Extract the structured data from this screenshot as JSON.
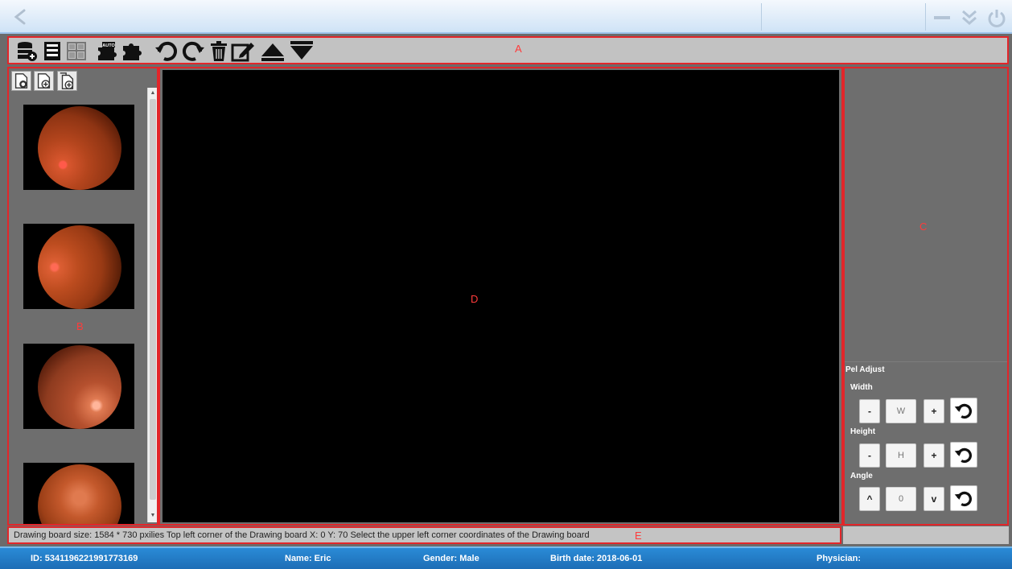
{
  "regions": {
    "toolbar": "A",
    "thumbnails": "B",
    "adjust_panel": "C",
    "drawing_board": "D",
    "status": "E"
  },
  "toolbar": {
    "tools": [
      "database-import-icon",
      "save-icon",
      "grid-icon",
      "auto-puzzle-icon",
      "puzzle-icon",
      "rotate-left-icon",
      "rotate-right-icon",
      "trash-icon",
      "edit-icon",
      "move-up-icon",
      "move-down-icon"
    ]
  },
  "thumbnail_panel": {
    "add_buttons": [
      "add-image-icon",
      "add-document-icon",
      "add-multiple-icon"
    ]
  },
  "pel_adjust": {
    "title": "Pel Adjust",
    "width": {
      "label": "Width",
      "minus": "-",
      "field": "W",
      "plus": "+"
    },
    "height": {
      "label": "Height",
      "minus": "-",
      "field": "H",
      "plus": "+"
    },
    "angle": {
      "label": "Angle",
      "up": "^",
      "field": "0",
      "down": "v"
    }
  },
  "status": {
    "text": "Drawing board size: 1584 * 730  pxilies    Top left corner of the Drawing board  X: 0  Y: 70   Select the upper left corner coordinates of the Drawing board"
  },
  "patient": {
    "id": "ID: 534119622199177316​9",
    "name": "Name: Eric",
    "gender": "Gender: Male",
    "birth": "Birth date: 2018-06-01",
    "physician": "Physician:"
  },
  "colors": {
    "accent_red": "#e2262a",
    "patient_bar": "#2a8bd6",
    "panel_gray": "#6e6e6e"
  }
}
